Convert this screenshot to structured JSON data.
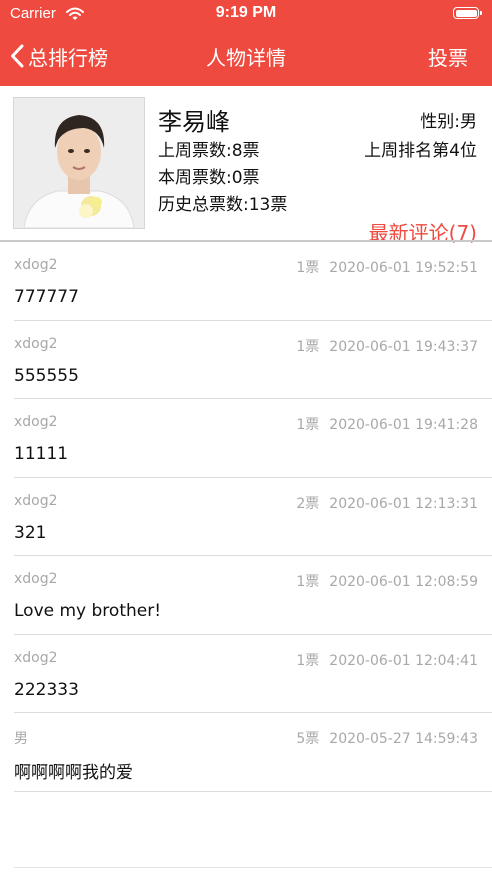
{
  "status_bar": {
    "carrier": "Carrier",
    "time": "9:19 PM"
  },
  "nav": {
    "back_label": "总排行榜",
    "title": "人物详情",
    "vote_label": "投票"
  },
  "profile": {
    "name": "李易峰",
    "gender": "性别:男",
    "last_week_votes": "上周票数:8票",
    "last_week_rank": "上周排名第4位",
    "this_week_votes": "本周票数:0票",
    "total_votes": "历史总票数:13票",
    "comments_link": "最新评论(7)"
  },
  "comments": [
    {
      "user": "xdog2",
      "votes": "1票",
      "time": "2020-06-01 19:52:51",
      "text": "777777"
    },
    {
      "user": "xdog2",
      "votes": "1票",
      "time": "2020-06-01 19:43:37",
      "text": "555555"
    },
    {
      "user": "xdog2",
      "votes": "1票",
      "time": "2020-06-01 19:41:28",
      "text": "11111"
    },
    {
      "user": "xdog2",
      "votes": "2票",
      "time": "2020-06-01 12:13:31",
      "text": "321"
    },
    {
      "user": "xdog2",
      "votes": "1票",
      "time": "2020-06-01 12:08:59",
      "text": "Love my brother!"
    },
    {
      "user": "xdog2",
      "votes": "1票",
      "time": "2020-06-01 12:04:41",
      "text": "222333"
    },
    {
      "user": "男",
      "votes": "5票",
      "time": "2020-05-27 14:59:43",
      "text": "啊啊啊啊我的爱"
    }
  ],
  "colors": {
    "accent": "#ef4a3f",
    "meta_text": "#a8a8a8"
  },
  "icons": {
    "back": "chevron-left-icon",
    "wifi": "wifi-icon",
    "battery": "battery-icon"
  }
}
